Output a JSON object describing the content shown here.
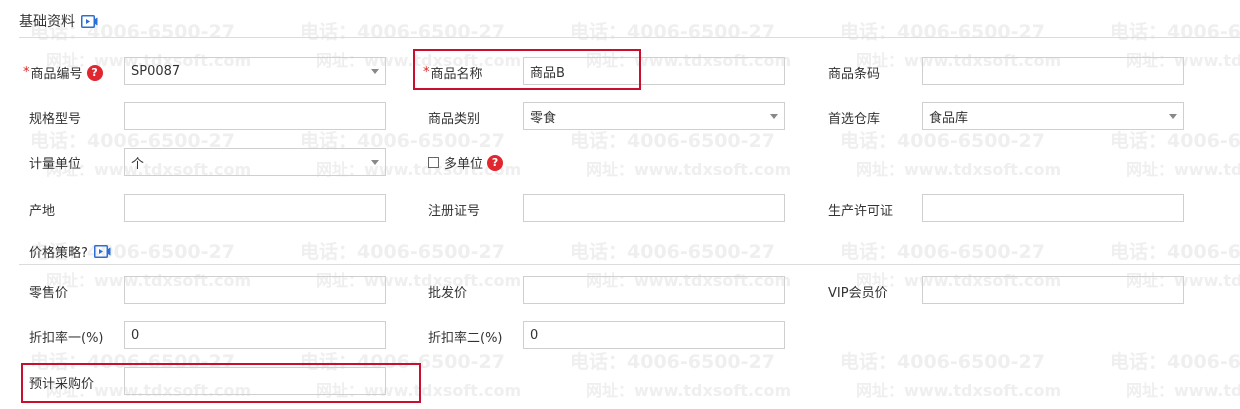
{
  "watermark": {
    "phone": "电话：4006-6500-27",
    "url": "网址：www.tdxsoft.com"
  },
  "basic_section": {
    "title": "基础资料",
    "video_icon": "video-play-icon"
  },
  "price_section": {
    "title": "价格策略?",
    "video_icon": "video-play-icon"
  },
  "fields": {
    "product_code": {
      "required_mark": "*",
      "label": "商品编号",
      "value": "SP0087",
      "help": "?"
    },
    "product_name": {
      "required_mark": "*",
      "label": "商品名称",
      "value": "商品B"
    },
    "barcode": {
      "label": "商品条码",
      "value": ""
    },
    "spec": {
      "label": "规格型号",
      "value": ""
    },
    "category": {
      "label": "商品类别",
      "value": "零食"
    },
    "warehouse": {
      "label": "首选仓库",
      "value": "食品库"
    },
    "unit": {
      "label": "计量单位",
      "value": "个"
    },
    "multi_unit": {
      "label": "多单位",
      "checked": false,
      "help": "?"
    },
    "origin": {
      "label": "产地",
      "value": ""
    },
    "reg_no": {
      "label": "注册证号",
      "value": ""
    },
    "license": {
      "label": "生产许可证",
      "value": ""
    },
    "retail_price": {
      "label": "零售价",
      "value": ""
    },
    "wholesale_price": {
      "label": "批发价",
      "value": ""
    },
    "vip_price": {
      "label": "VIP会员价",
      "value": ""
    },
    "discount1": {
      "label": "折扣率一(%)",
      "value": "0"
    },
    "discount2": {
      "label": "折扣率二(%)",
      "value": "0"
    },
    "purchase_price": {
      "label": "预计采购价",
      "value": ""
    }
  },
  "colors": {
    "highlight": "#c8102e",
    "required": "#e02020",
    "help_bg": "#e0262e",
    "link_blue": "#2b6fd6"
  }
}
